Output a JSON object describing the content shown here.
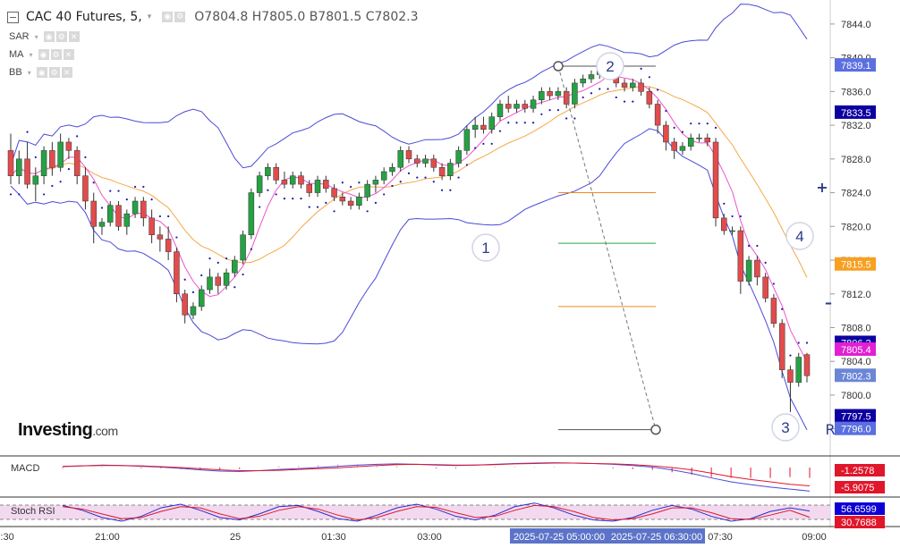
{
  "header": {
    "title": "CAC 40 Futures, 5,",
    "ohlc": {
      "open": "O7804.8",
      "high": "H7805.0",
      "low": "B7801.5",
      "close": "C7802.3"
    }
  },
  "indicators": [
    "SAR",
    "MA",
    "BB"
  ],
  "logo": {
    "name": "Investing",
    "suffix": ".com"
  },
  "side_buttons": {
    "plus": "+",
    "minus": "–",
    "reset": "R"
  },
  "annotations": [
    "1",
    "2",
    "3",
    "4"
  ],
  "lower_panels": [
    {
      "label": "MACD",
      "values": [
        "-1.2578",
        "-5.9075"
      ],
      "colors": [
        "#e0162b",
        "#e0162b"
      ]
    },
    {
      "label": "Stoch RSI",
      "values": [
        "56.6599",
        "30.7688"
      ],
      "colors": [
        "#0d00d6",
        "#e0162b"
      ]
    }
  ],
  "time_axis": {
    "labels": [
      "0:30",
      "21:00",
      "25",
      "01:30",
      "03:00",
      "07:30",
      "09:00"
    ],
    "highlight": [
      "2025-07-25 05:00:00",
      "2025-07-25 06:30:00"
    ]
  },
  "price_axis": {
    "ticks": [
      "7844.0",
      "7840.0",
      "7836.0",
      "7832.0",
      "7828.0",
      "7824.0",
      "7820.0",
      "7816.0",
      "7812.0",
      "7808.0",
      "7804.0",
      "7800.0",
      "7796.0"
    ],
    "badges": [
      {
        "value": "7839.1",
        "bg": "#5b6fe0"
      },
      {
        "value": "7833.5",
        "bg": "#0d00a0"
      },
      {
        "value": "7815.5",
        "bg": "#f7a021"
      },
      {
        "value": "7806.2",
        "bg": "#0d00a0"
      },
      {
        "value": "7805.4",
        "bg": "#e21fd4"
      },
      {
        "value": "7802.3",
        "bg": "#6b86d6"
      },
      {
        "value": "7797.5",
        "bg": "#0d00a0"
      },
      {
        "value": "7796.0",
        "bg": "#5b6fe0"
      }
    ]
  },
  "colors": {
    "up": "#26a144",
    "down": "#e24c4c",
    "bb": "#4a4ad9",
    "ma_fast": "#ee55cc",
    "ma_slow": "#f5a84a",
    "sar": "#1a1aa8"
  },
  "chart_data": {
    "type": "candlestick",
    "title": "CAC 40 Futures, 5,",
    "ylim": [
      7793,
      7846
    ],
    "candles": [
      [
        7829.0,
        7831.0,
        7825.0,
        7826.0
      ],
      [
        7826.0,
        7829.0,
        7825.0,
        7828.0
      ],
      [
        7828.0,
        7830.0,
        7824.5,
        7825.0
      ],
      [
        7825.0,
        7827.0,
        7823.0,
        7826.0
      ],
      [
        7826.0,
        7829.5,
        7825.0,
        7829.0
      ],
      [
        7829.0,
        7830.0,
        7826.0,
        7827.0
      ],
      [
        7827.0,
        7831.0,
        7826.5,
        7830.0
      ],
      [
        7830.0,
        7830.5,
        7828.0,
        7829.0
      ],
      [
        7829.0,
        7829.5,
        7825.0,
        7826.0
      ],
      [
        7826.0,
        7827.0,
        7822.0,
        7823.0
      ],
      [
        7823.0,
        7824.0,
        7818.0,
        7820.0
      ],
      [
        7820.0,
        7821.0,
        7819.0,
        7820.5
      ],
      [
        7820.5,
        7823.0,
        7820.0,
        7822.5
      ],
      [
        7822.5,
        7823.0,
        7819.5,
        7820.0
      ],
      [
        7820.0,
        7822.0,
        7819.0,
        7821.5
      ],
      [
        7821.5,
        7823.5,
        7821.0,
        7823.0
      ],
      [
        7823.0,
        7823.5,
        7820.0,
        7821.0
      ],
      [
        7821.0,
        7822.0,
        7818.0,
        7819.0
      ],
      [
        7819.0,
        7820.0,
        7817.0,
        7818.5
      ],
      [
        7818.5,
        7820.0,
        7816.0,
        7817.0
      ],
      [
        7817.0,
        7817.5,
        7811.0,
        7812.0
      ],
      [
        7812.0,
        7812.5,
        7808.5,
        7809.5
      ],
      [
        7809.5,
        7811.0,
        7809.0,
        7810.5
      ],
      [
        7810.5,
        7813.0,
        7810.0,
        7812.5
      ],
      [
        7812.5,
        7815.0,
        7812.0,
        7814.0
      ],
      [
        7814.0,
        7814.5,
        7812.0,
        7813.0
      ],
      [
        7813.0,
        7815.0,
        7812.5,
        7814.5
      ],
      [
        7814.5,
        7816.5,
        7814.0,
        7816.0
      ],
      [
        7816.0,
        7819.5,
        7815.5,
        7819.0
      ],
      [
        7819.0,
        7824.5,
        7818.5,
        7824.0
      ],
      [
        7824.0,
        7826.5,
        7823.5,
        7826.0
      ],
      [
        7826.0,
        7827.5,
        7825.5,
        7827.0
      ],
      [
        7827.0,
        7827.5,
        7825.0,
        7825.5
      ],
      [
        7825.5,
        7826.5,
        7824.5,
        7825.0
      ],
      [
        7825.0,
        7826.5,
        7824.5,
        7826.0
      ],
      [
        7826.0,
        7826.5,
        7824.5,
        7825.0
      ],
      [
        7825.0,
        7825.5,
        7823.5,
        7824.0
      ],
      [
        7824.0,
        7826.0,
        7823.5,
        7825.5
      ],
      [
        7825.5,
        7826.0,
        7824.0,
        7824.5
      ],
      [
        7824.5,
        7825.0,
        7823.0,
        7823.5
      ],
      [
        7823.5,
        7824.0,
        7822.5,
        7823.0
      ],
      [
        7823.0,
        7823.5,
        7822.0,
        7822.5
      ],
      [
        7822.5,
        7824.0,
        7822.0,
        7823.5
      ],
      [
        7823.5,
        7825.5,
        7823.0,
        7825.0
      ],
      [
        7825.0,
        7826.0,
        7824.0,
        7825.5
      ],
      [
        7825.5,
        7827.0,
        7825.0,
        7826.5
      ],
      [
        7826.5,
        7827.5,
        7826.0,
        7827.0
      ],
      [
        7827.0,
        7829.5,
        7826.5,
        7829.0
      ],
      [
        7829.0,
        7829.5,
        7827.5,
        7828.0
      ],
      [
        7828.0,
        7828.5,
        7827.0,
        7827.5
      ],
      [
        7827.5,
        7828.5,
        7827.0,
        7828.0
      ],
      [
        7828.0,
        7828.5,
        7826.5,
        7827.0
      ],
      [
        7827.0,
        7827.5,
        7825.5,
        7826.0
      ],
      [
        7826.0,
        7828.0,
        7825.5,
        7827.5
      ],
      [
        7827.5,
        7829.5,
        7827.0,
        7829.0
      ],
      [
        7829.0,
        7832.0,
        7828.5,
        7831.5
      ],
      [
        7831.5,
        7833.0,
        7830.5,
        7832.0
      ],
      [
        7832.0,
        7833.0,
        7831.0,
        7831.5
      ],
      [
        7831.5,
        7833.5,
        7831.0,
        7833.0
      ],
      [
        7833.0,
        7835.0,
        7832.5,
        7834.5
      ],
      [
        7834.5,
        7835.5,
        7833.5,
        7834.0
      ],
      [
        7834.0,
        7835.0,
        7833.5,
        7834.5
      ],
      [
        7834.5,
        7835.0,
        7833.5,
        7834.0
      ],
      [
        7834.0,
        7835.5,
        7833.5,
        7835.0
      ],
      [
        7835.0,
        7836.5,
        7834.5,
        7836.0
      ],
      [
        7836.0,
        7836.5,
        7835.0,
        7835.5
      ],
      [
        7835.5,
        7836.5,
        7835.0,
        7836.0
      ],
      [
        7836.0,
        7836.5,
        7834.0,
        7834.5
      ],
      [
        7834.5,
        7837.5,
        7834.0,
        7837.0
      ],
      [
        7837.0,
        7838.0,
        7836.5,
        7837.5
      ],
      [
        7837.5,
        7838.5,
        7837.0,
        7838.0
      ],
      [
        7838.0,
        7839.0,
        7837.5,
        7838.5
      ],
      [
        7838.5,
        7839.0,
        7837.5,
        7838.0
      ],
      [
        7838.0,
        7838.5,
        7836.5,
        7837.0
      ],
      [
        7837.0,
        7837.5,
        7836.0,
        7836.5
      ],
      [
        7836.5,
        7837.5,
        7836.0,
        7837.0
      ],
      [
        7837.0,
        7837.5,
        7835.5,
        7836.0
      ],
      [
        7836.0,
        7836.5,
        7834.0,
        7834.5
      ],
      [
        7834.5,
        7835.0,
        7831.0,
        7832.0
      ],
      [
        7832.0,
        7832.5,
        7829.0,
        7830.0
      ],
      [
        7830.0,
        7830.5,
        7828.0,
        7829.0
      ],
      [
        7829.0,
        7830.0,
        7828.5,
        7829.5
      ],
      [
        7829.5,
        7831.0,
        7829.0,
        7830.5
      ],
      [
        7830.5,
        7831.0,
        7830.0,
        7830.5
      ],
      [
        7830.5,
        7831.0,
        7829.5,
        7830.0
      ],
      [
        7830.0,
        7830.5,
        7820.0,
        7821.0
      ],
      [
        7821.0,
        7821.5,
        7819.0,
        7819.5
      ],
      [
        7819.5,
        7820.0,
        7819.0,
        7819.5
      ],
      [
        7819.5,
        7820.0,
        7812.0,
        7813.5
      ],
      [
        7813.5,
        7816.5,
        7813.0,
        7816.0
      ],
      [
        7816.0,
        7816.5,
        7813.0,
        7814.0
      ],
      [
        7814.0,
        7814.5,
        7811.0,
        7811.5
      ],
      [
        7811.5,
        7812.0,
        7808.0,
        7808.5
      ],
      [
        7808.5,
        7809.0,
        7802.0,
        7803.0
      ],
      [
        7803.0,
        7803.5,
        7798.0,
        7801.5
      ],
      [
        7801.5,
        7805.0,
        7801.0,
        7804.5
      ],
      [
        7804.8,
        7805.0,
        7801.5,
        7802.3
      ]
    ],
    "macd": [
      0.2,
      0.4,
      0.6,
      0.5,
      0.3,
      0.1,
      -0.2,
      -0.6,
      -0.9,
      -1.0,
      -0.8,
      -0.5,
      -0.3,
      0.0,
      0.3,
      0.6,
      0.8,
      0.9,
      0.8,
      0.6,
      0.5,
      0.6,
      0.8,
      1.0,
      1.1,
      1.2,
      1.1,
      1.0,
      0.8,
      0.5,
      0.1,
      -0.6,
      -1.5,
      -2.6,
      -3.6,
      -4.3,
      -4.9,
      -5.4,
      -5.9
    ],
    "macd_signal": [
      0.3,
      0.4,
      0.5,
      0.5,
      0.4,
      0.2,
      0.0,
      -0.3,
      -0.6,
      -0.8,
      -0.8,
      -0.7,
      -0.5,
      -0.3,
      -0.1,
      0.2,
      0.5,
      0.7,
      0.8,
      0.7,
      0.6,
      0.6,
      0.7,
      0.9,
      1.0,
      1.1,
      1.1,
      1.0,
      0.9,
      0.7,
      0.4,
      0.0,
      -0.6,
      -1.4,
      -2.3,
      -3.0,
      -3.6,
      -4.2,
      -4.6
    ],
    "stoch_k": [
      80,
      60,
      30,
      15,
      35,
      70,
      85,
      60,
      30,
      20,
      45,
      75,
      80,
      55,
      25,
      15,
      40,
      70,
      85,
      65,
      35,
      20,
      40,
      75,
      90,
      70,
      40,
      20,
      15,
      30,
      60,
      80,
      65,
      35,
      15,
      25,
      55,
      70,
      57
    ],
    "stoch_d": [
      75,
      65,
      45,
      25,
      30,
      55,
      75,
      70,
      45,
      25,
      35,
      60,
      75,
      65,
      40,
      20,
      30,
      55,
      75,
      72,
      50,
      30,
      35,
      60,
      80,
      75,
      55,
      30,
      20,
      25,
      45,
      70,
      70,
      50,
      25,
      22,
      40,
      60,
      31
    ],
    "drawings": {
      "fib_levels": [
        7824.0,
        7818.0,
        7810.5
      ],
      "diag_line_start": 7839.0,
      "diag_line_end": 7795.9
    }
  }
}
